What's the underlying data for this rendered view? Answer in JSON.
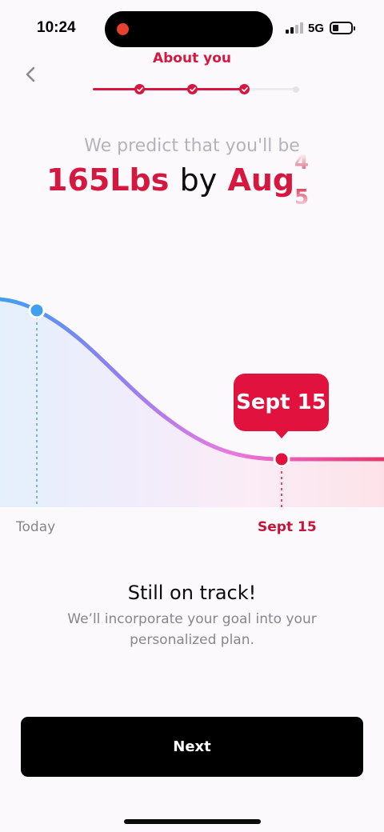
{
  "status_bar": {
    "time": "10:24",
    "network": "5G",
    "recording_indicator_color": "#e8412e",
    "signal_bars_active": 2,
    "signal_bars_total": 4,
    "battery_level": 0.2
  },
  "header": {
    "title": "About you",
    "back_icon": "chevron-left-icon",
    "progress": {
      "steps_total": 4,
      "steps_completed": 3,
      "accent_color": "#d5183f"
    }
  },
  "prediction": {
    "intro": "We predict that you'll be",
    "weight": "165Lbs",
    "connector": "by",
    "month": "Aug",
    "rolling_digits": [
      "4",
      "5"
    ]
  },
  "chart_data": {
    "type": "line",
    "points": [
      {
        "label": "Today",
        "marker_color": "#3fa0f0"
      },
      {
        "label": "Sept 15",
        "marker_color": "#e1123d"
      }
    ],
    "tooltip": "Sept 15",
    "gradient_colors": [
      "#3fa0f0",
      "#8f7ff0",
      "#e87ae0",
      "#e8346a"
    ]
  },
  "axis": {
    "start_label": "Today",
    "end_label": "Sept 15"
  },
  "message": {
    "title": "Still on track!",
    "body": "We’ll incorporate your goal into your personalized plan."
  },
  "actions": {
    "next_label": "Next"
  }
}
